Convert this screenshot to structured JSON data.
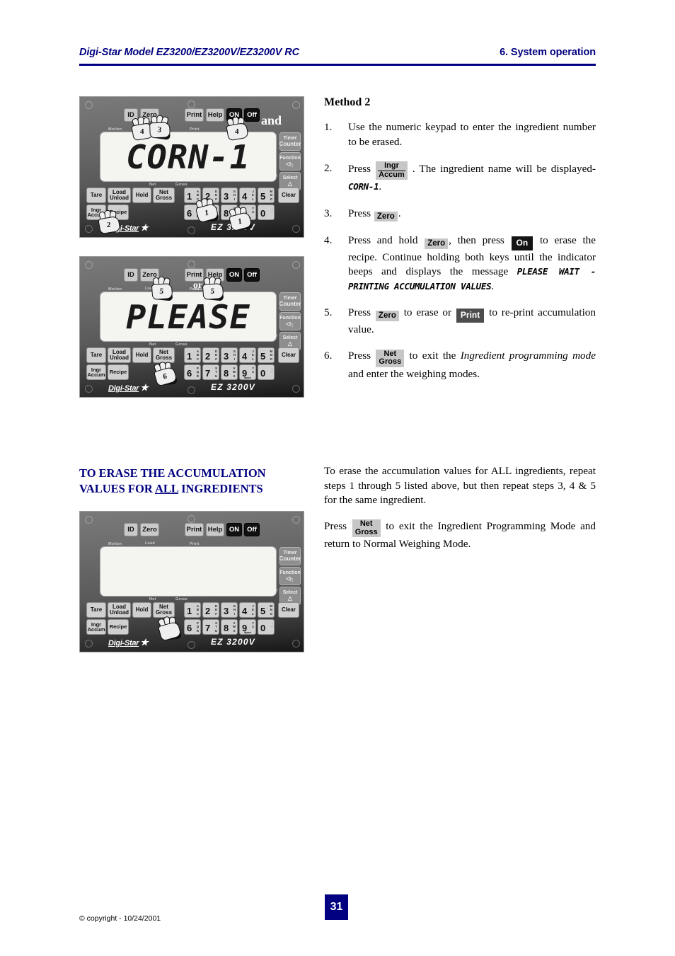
{
  "header": {
    "left": "Digi-Star Model EZ3200/EZ3200V/EZ3200V RC",
    "right": "6. System operation",
    "accent_color": "#000080"
  },
  "method": {
    "title": "Method 2",
    "steps": [
      {
        "num": "1.",
        "parts": [
          {
            "type": "text",
            "text": "Use the numeric keypad to enter the ingredient number to be erased."
          }
        ]
      },
      {
        "num": "2.",
        "parts": [
          {
            "type": "text",
            "text": "Press "
          },
          {
            "type": "key2",
            "line1": "Ingr",
            "line2": "Accum",
            "style": "grey"
          },
          {
            "type": "text",
            "text": " . The ingredient name will be displayed-"
          },
          {
            "type": "lcd",
            "text": "CORN-1"
          },
          {
            "type": "text",
            "text": "."
          }
        ]
      },
      {
        "num": "3.",
        "parts": [
          {
            "type": "text",
            "text": "Press "
          },
          {
            "type": "key",
            "label": "Zero",
            "style": "grey"
          },
          {
            "type": "text",
            "text": "."
          }
        ]
      },
      {
        "num": "4.",
        "parts": [
          {
            "type": "text",
            "text": "Press and hold "
          },
          {
            "type": "key",
            "label": "Zero",
            "style": "grey"
          },
          {
            "type": "text",
            "text": ", then press "
          },
          {
            "type": "key",
            "label": "On",
            "style": "black"
          },
          {
            "type": "text",
            "text": " to erase the recipe.  Continue holding both keys until the indicator beeps and displays the message "
          },
          {
            "type": "lcd",
            "text": "PLEASE WAIT - PRINTING ACCUMULATION VALUES"
          },
          {
            "type": "text",
            "text": "."
          }
        ]
      },
      {
        "num": "5.",
        "parts": [
          {
            "type": "text",
            "text": "Press "
          },
          {
            "type": "key",
            "label": "Zero",
            "style": "grey"
          },
          {
            "type": "text",
            "text": " to erase or "
          },
          {
            "type": "key",
            "label": "Print",
            "style": "dark"
          },
          {
            "type": "text",
            "text": " to re-print accumulation value."
          }
        ]
      },
      {
        "num": "6.",
        "parts": [
          {
            "type": "text",
            "text": "Press "
          },
          {
            "type": "key2",
            "line1": "Net",
            "line2": "Gross",
            "style": "grey-nodiv"
          },
          {
            "type": "text",
            "text": " to exit the "
          },
          {
            "type": "ital",
            "text": "Ingredient  programming mode"
          },
          {
            "type": "text",
            "text": " and enter the weighing modes."
          }
        ]
      }
    ]
  },
  "section": {
    "heading_line1": "TO ERASE THE ACCUMULATION",
    "heading_line2_pre": "VALUES FOR ",
    "heading_line2_underline": "ALL",
    "heading_line2_post": " INGREDIENTS",
    "paragraph1": "To erase the accumulation values for ALL ingredients, repeat steps 1 through 5 listed above, but then repeat steps 3, 4 & 5 for the same ingredient.",
    "paragraph2_parts": [
      {
        "type": "text",
        "text": "Press "
      },
      {
        "type": "key2",
        "line1": "Net",
        "line2": "Gross",
        "style": "grey-nodiv"
      },
      {
        "type": "text",
        "text": " to exit the Ingredient Programming Mode and return to Normal Weighing Mode."
      }
    ]
  },
  "device_common": {
    "top_buttons": [
      {
        "label": "ID",
        "style": "light"
      },
      {
        "label": "Zero",
        "style": "light"
      },
      {
        "label": "Print",
        "style": "light"
      },
      {
        "label": "Help",
        "style": "light"
      },
      {
        "label": "ON",
        "style": "black"
      },
      {
        "label": "Off",
        "style": "black"
      }
    ],
    "indicator_labels": [
      "Motion",
      "Load",
      "Print",
      "Net",
      "Gross"
    ],
    "unit_labels": [
      "lb",
      "kg"
    ],
    "side_buttons": [
      {
        "line1": "Timer",
        "line2": "Counter"
      },
      {
        "line1": "Function",
        "line2": "◁┐"
      },
      {
        "line1": "Select",
        "line2": "△"
      }
    ],
    "function_buttons": [
      {
        "line1": "Tare",
        "line2": ""
      },
      {
        "line1": "Load",
        "line2": "Unload"
      },
      {
        "line1": "Hold",
        "line2": ""
      },
      {
        "line1": "Net",
        "line2": "Gross"
      }
    ],
    "function_buttons_row2": [
      {
        "line1": "Ingr",
        "line2": "Accum"
      },
      {
        "line1": "Recipe",
        "line2": ""
      }
    ],
    "clear_button": "Clear",
    "keypad": [
      {
        "digit": "1",
        "letters": "ABC",
        "sub": ""
      },
      {
        "digit": "2",
        "letters": "DEF",
        "sub": ""
      },
      {
        "digit": "3",
        "letters": "GHI",
        "sub": ""
      },
      {
        "digit": "4",
        "letters": "JKL",
        "sub": ""
      },
      {
        "digit": "5",
        "letters": "MNO",
        "sub": ""
      },
      {
        "digit": "6",
        "letters": "PQR",
        "sub": ""
      },
      {
        "digit": "7",
        "letters": "STU",
        "sub": ""
      },
      {
        "digit": "8",
        "letters": "VWX",
        "sub": ""
      },
      {
        "digit": "9",
        "letters": "YZ",
        "sub": "Space"
      },
      {
        "digit": "0",
        "letters": ".-",
        "sub": ""
      }
    ],
    "brand": "Digi-Star",
    "brand_icon": "star-icon",
    "model": "EZ 3200V"
  },
  "device1": {
    "display_text": "CORN-1",
    "hand_markers": [
      "4",
      "3",
      "4",
      "2",
      "1",
      "1"
    ],
    "overlay_label": "and"
  },
  "device2": {
    "display_text": "PLEASE",
    "hand_markers": [
      "5",
      "5",
      "6"
    ],
    "overlay_label": "or"
  },
  "device3": {
    "display_text": "",
    "hand_markers": [
      ""
    ]
  },
  "footer": {
    "copyright": "© copyright - 10/24/2001",
    "page_number": "31"
  }
}
